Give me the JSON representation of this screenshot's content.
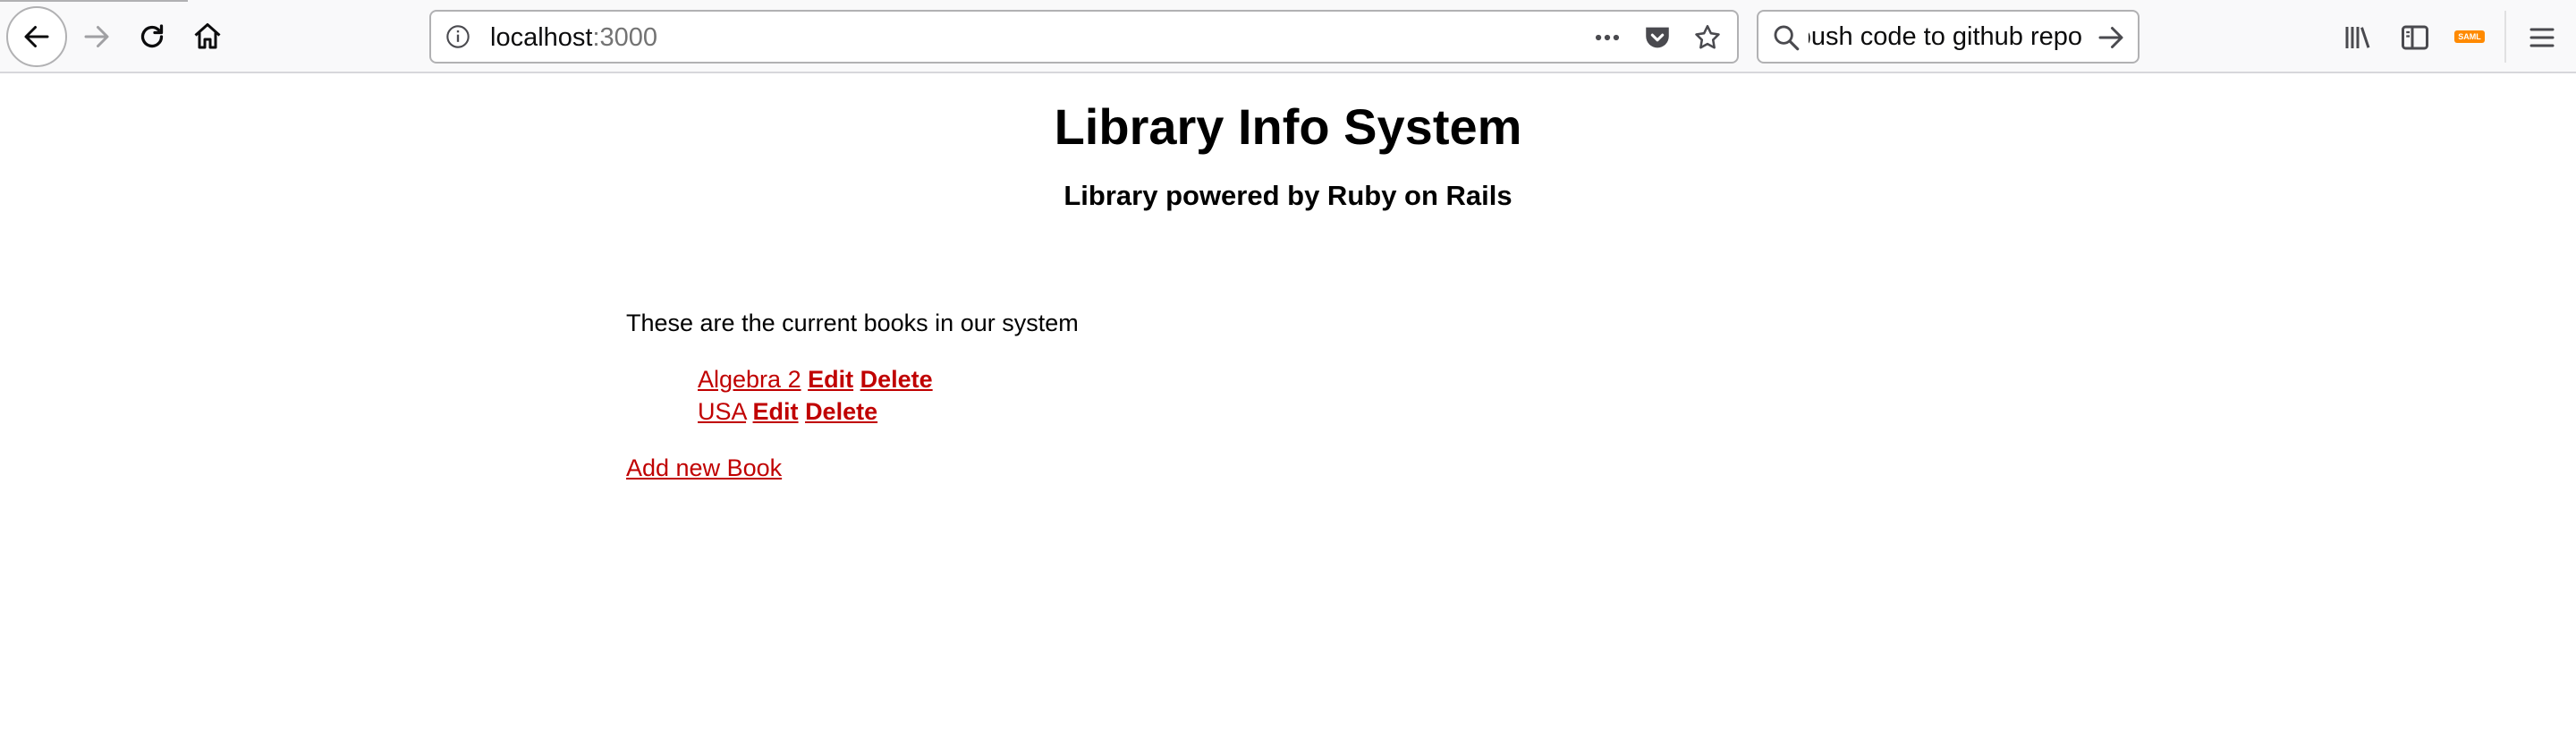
{
  "browser": {
    "url_host": "localhost",
    "url_rest": ":3000",
    "search_text": "push code to github repo"
  },
  "header": {
    "title": "Library Info System",
    "subtitle": "Library powered by Ruby on Rails"
  },
  "main": {
    "intro": "These are the current books in our system",
    "books": [
      {
        "title": "Algebra 2",
        "edit_label": "Edit",
        "delete_label": "Delete"
      },
      {
        "title": "USA",
        "edit_label": "Edit",
        "delete_label": "Delete"
      }
    ],
    "add_link": "Add new Book"
  },
  "toolbar_right": {
    "saml_badge": "SAML"
  },
  "colors": {
    "link": "#c00000",
    "accent": "#0a84ff",
    "saml_badge": "#ff8a00"
  }
}
